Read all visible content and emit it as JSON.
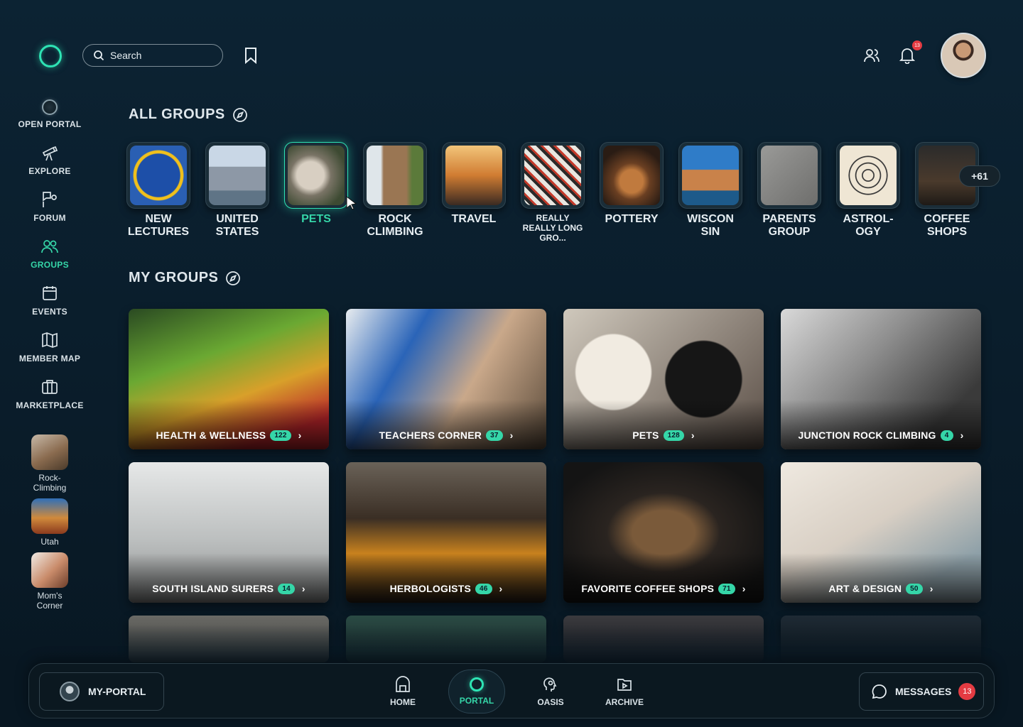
{
  "search": {
    "placeholder": "Search"
  },
  "notifications": {
    "count": "13"
  },
  "sidebar": {
    "items": [
      {
        "label": "OPEN PORTAL"
      },
      {
        "label": "EXPLORE"
      },
      {
        "label": "FORUM"
      },
      {
        "label": "GROUPS"
      },
      {
        "label": "EVENTS"
      },
      {
        "label": "MEMBER MAP"
      },
      {
        "label": "MARKETPLACE"
      }
    ],
    "shortcuts": [
      {
        "label": "Rock-\nClimbing"
      },
      {
        "label": "Utah"
      },
      {
        "label": "Mom's\nCorner"
      }
    ]
  },
  "all_groups": {
    "title": "ALL GROUPS",
    "items": [
      {
        "label": "NEW LECTURES"
      },
      {
        "label": "UNITED STATES"
      },
      {
        "label": "PETS"
      },
      {
        "label": "ROCK CLIMBING"
      },
      {
        "label": "TRAVEL"
      },
      {
        "label": "REALLY REALLY LONG GRO..."
      },
      {
        "label": "POTTERY"
      },
      {
        "label": "WISCON SIN"
      },
      {
        "label": "PARENTS GROUP"
      },
      {
        "label": "ASTROL-OGY"
      },
      {
        "label": "COFFEE SHOPS"
      }
    ],
    "more": "+61"
  },
  "my_groups": {
    "title": "MY GROUPS",
    "cards": [
      {
        "name": "HEALTH & WELLNESS",
        "count": "122"
      },
      {
        "name": "TEACHERS CORNER",
        "count": "37"
      },
      {
        "name": "PETS",
        "count": "128"
      },
      {
        "name": "JUNCTION ROCK CLIMBING",
        "count": "4"
      },
      {
        "name": "SOUTH ISLAND SURERS",
        "count": "14"
      },
      {
        "name": "HERBOLOGISTS",
        "count": "46"
      },
      {
        "name": "FAVORITE COFFEE SHOPS",
        "count": "71"
      },
      {
        "name": "ART & DESIGN",
        "count": "50"
      }
    ]
  },
  "bottom_nav": {
    "my_portal": "MY-PORTAL",
    "items": [
      {
        "label": "HOME"
      },
      {
        "label": "PORTAL"
      },
      {
        "label": "OASIS"
      },
      {
        "label": "ARCHIVE"
      }
    ],
    "messages": "MESSAGES",
    "messages_count": "13"
  },
  "colors": {
    "accent": "#35d6a8",
    "background": "#0b1f2d",
    "badge": "#e43b42"
  }
}
